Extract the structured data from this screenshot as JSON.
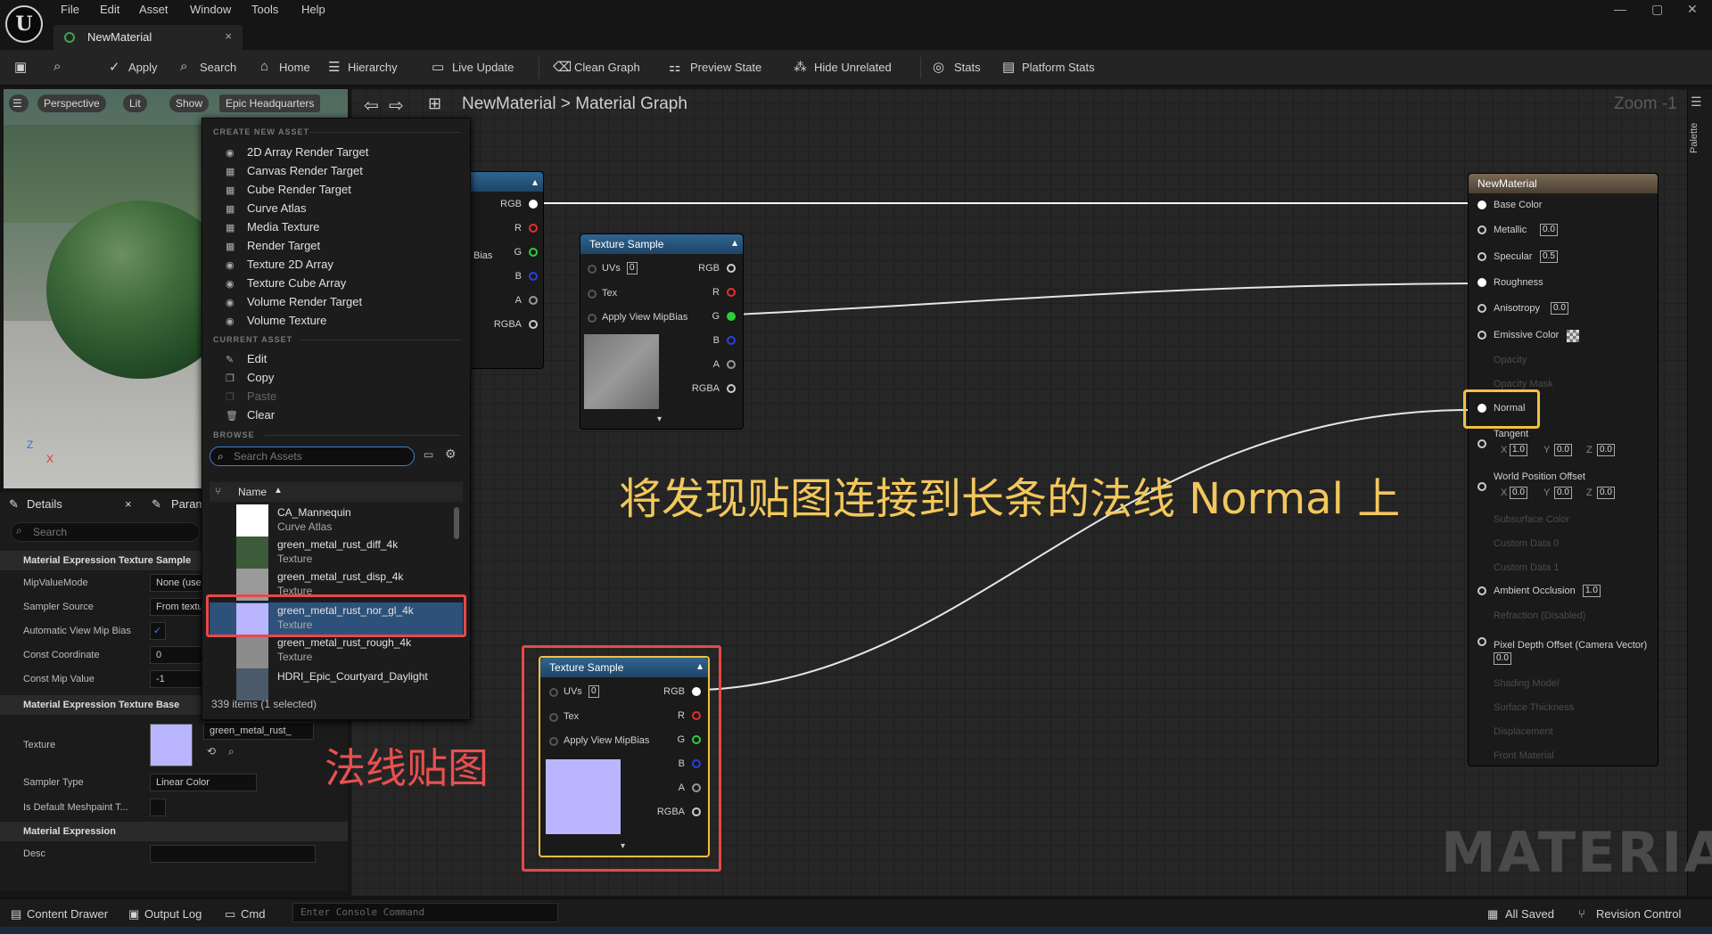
{
  "menu": [
    "File",
    "Edit",
    "Asset",
    "Window",
    "Tools",
    "Help"
  ],
  "tab": {
    "label": "NewMaterial",
    "close": "×"
  },
  "window_controls": [
    "—",
    "▢",
    "✕"
  ],
  "toolbar": {
    "apply": "Apply",
    "search": "Search",
    "home": "Home",
    "hierarchy": "Hierarchy",
    "live_update": "Live Update",
    "clean_graph": "Clean Graph",
    "preview_state": "Preview State",
    "hide_unrelated": "Hide Unrelated",
    "stats": "Stats",
    "platform_stats": "Platform Stats"
  },
  "viewport": {
    "perspective": "Perspective",
    "lit": "Lit",
    "show": "Show",
    "level": "Epic Headquarters",
    "axes": {
      "z": "Z",
      "x": "X"
    }
  },
  "details": {
    "tab1": "Details",
    "tab2": "Param",
    "search_placeholder": "Search",
    "section1": "Material Expression Texture Sample",
    "props1": [
      {
        "name": "MipValueMode",
        "value": "None (use"
      },
      {
        "name": "Sampler Source",
        "value": "From textu"
      },
      {
        "name": "Automatic View Mip Bias",
        "value": "✓"
      },
      {
        "name": "Const Coordinate",
        "value": "0"
      },
      {
        "name": "Const Mip Value",
        "value": "-1"
      }
    ],
    "section2": "Material Expression Texture Base",
    "texture_label": "Texture",
    "texture_value": "green_metal_rust_",
    "sampler_type_label": "Sampler Type",
    "sampler_type_value": "Linear Color",
    "default_meshpaint_label": "Is Default Meshpaint T...",
    "section3": "Material Expression",
    "desc_label": "Desc"
  },
  "breadcrumb": {
    "asset": "NewMaterial",
    "sep": ">",
    "graph": "Material Graph"
  },
  "zoom": "Zoom -1",
  "palette": "Palette",
  "dropdown": {
    "create_header": "CREATE NEW ASSET",
    "create_items": [
      "2D Array Render Target",
      "Canvas Render Target",
      "Cube Render Target",
      "Curve Atlas",
      "Media Texture",
      "Render Target",
      "Texture 2D Array",
      "Texture Cube Array",
      "Volume Render Target",
      "Volume Texture"
    ],
    "current_header": "CURRENT ASSET",
    "current_items": [
      "Edit",
      "Copy",
      "Paste",
      "Clear"
    ],
    "browse_header": "BROWSE",
    "search_placeholder": "Search Assets",
    "name_col": "Name",
    "assets": [
      {
        "name": "CA_Mannequin",
        "type": "Curve Atlas",
        "color": "#ffffff"
      },
      {
        "name": "green_metal_rust_diff_4k",
        "type": "Texture",
        "color": "#3d5b3a"
      },
      {
        "name": "green_metal_rust_disp_4k",
        "type": "Texture",
        "color": "#9a9a9a"
      },
      {
        "name": "green_metal_rust_nor_gl_4k",
        "type": "Texture",
        "color": "#b9b6ff"
      },
      {
        "name": "green_metal_rust_rough_4k",
        "type": "Texture",
        "color": "#8c8c8c"
      },
      {
        "name": "HDRI_Epic_Courtyard_Daylight",
        "type": "",
        "color": "#4a5a6a"
      }
    ],
    "count": "339 items (1 selected)"
  },
  "node_left": {
    "pins": [
      "RGB",
      "R",
      "G",
      "B",
      "A",
      "RGBA"
    ],
    "bias": "Bias"
  },
  "node_mid": {
    "title": "Texture Sample",
    "inputs": [
      "UVs",
      "Tex",
      "Apply View MipBias"
    ],
    "uv_value": "0",
    "outputs": [
      "RGB",
      "R",
      "G",
      "B",
      "A",
      "RGBA"
    ]
  },
  "node_bottom": {
    "title": "Texture Sample",
    "inputs": [
      "UVs",
      "Tex",
      "Apply View MipBias"
    ],
    "uv_value": "0",
    "outputs": [
      "RGB",
      "R",
      "G",
      "B",
      "A",
      "RGBA"
    ]
  },
  "material_node": {
    "title": "NewMaterial",
    "base_color": "Base Color",
    "metallic": "Metallic",
    "metallic_v": "0.0",
    "specular": "Specular",
    "specular_v": "0.5",
    "roughness": "Roughness",
    "anisotropy": "Anisotropy",
    "anisotropy_v": "0.0",
    "emissive": "Emissive Color",
    "opacity": "Opacity",
    "opacity_mask": "Opacity Mask",
    "normal": "Normal",
    "tangent": "Tangent",
    "tangent_vals": {
      "x": "1.0",
      "y": "0.0",
      "z": "0.0"
    },
    "wpo": "World Position Offset",
    "wpo_vals": {
      "x": "0.0",
      "y": "0.0",
      "z": "0.0"
    },
    "subsurface": "Subsurface Color",
    "custom0": "Custom Data 0",
    "custom1": "Custom Data 1",
    "ao": "Ambient Occlusion",
    "ao_v": "1.0",
    "refraction": "Refraction (Disabled)",
    "pdo": "Pixel Depth Offset (Camera Vector)",
    "pdo_v": "0.0",
    "shading": "Shading Model",
    "thickness": "Surface Thickness",
    "displacement": "Displacement",
    "front": "Front Material"
  },
  "annotations": {
    "main": "将发现贴图连接到长条的法线 Normal 上",
    "texture": "法线贴图"
  },
  "watermark": "MATERIAL",
  "statusbar": {
    "content_drawer": "Content Drawer",
    "output_log": "Output Log",
    "cmd": "Cmd",
    "console_placeholder": "Enter Console Command",
    "all_saved": "All Saved",
    "revision_control": "Revision Control"
  },
  "colors": {
    "highlight_red": "#e8484a",
    "highlight_yellow": "#f2c040",
    "accent_blue": "#2f6591"
  }
}
